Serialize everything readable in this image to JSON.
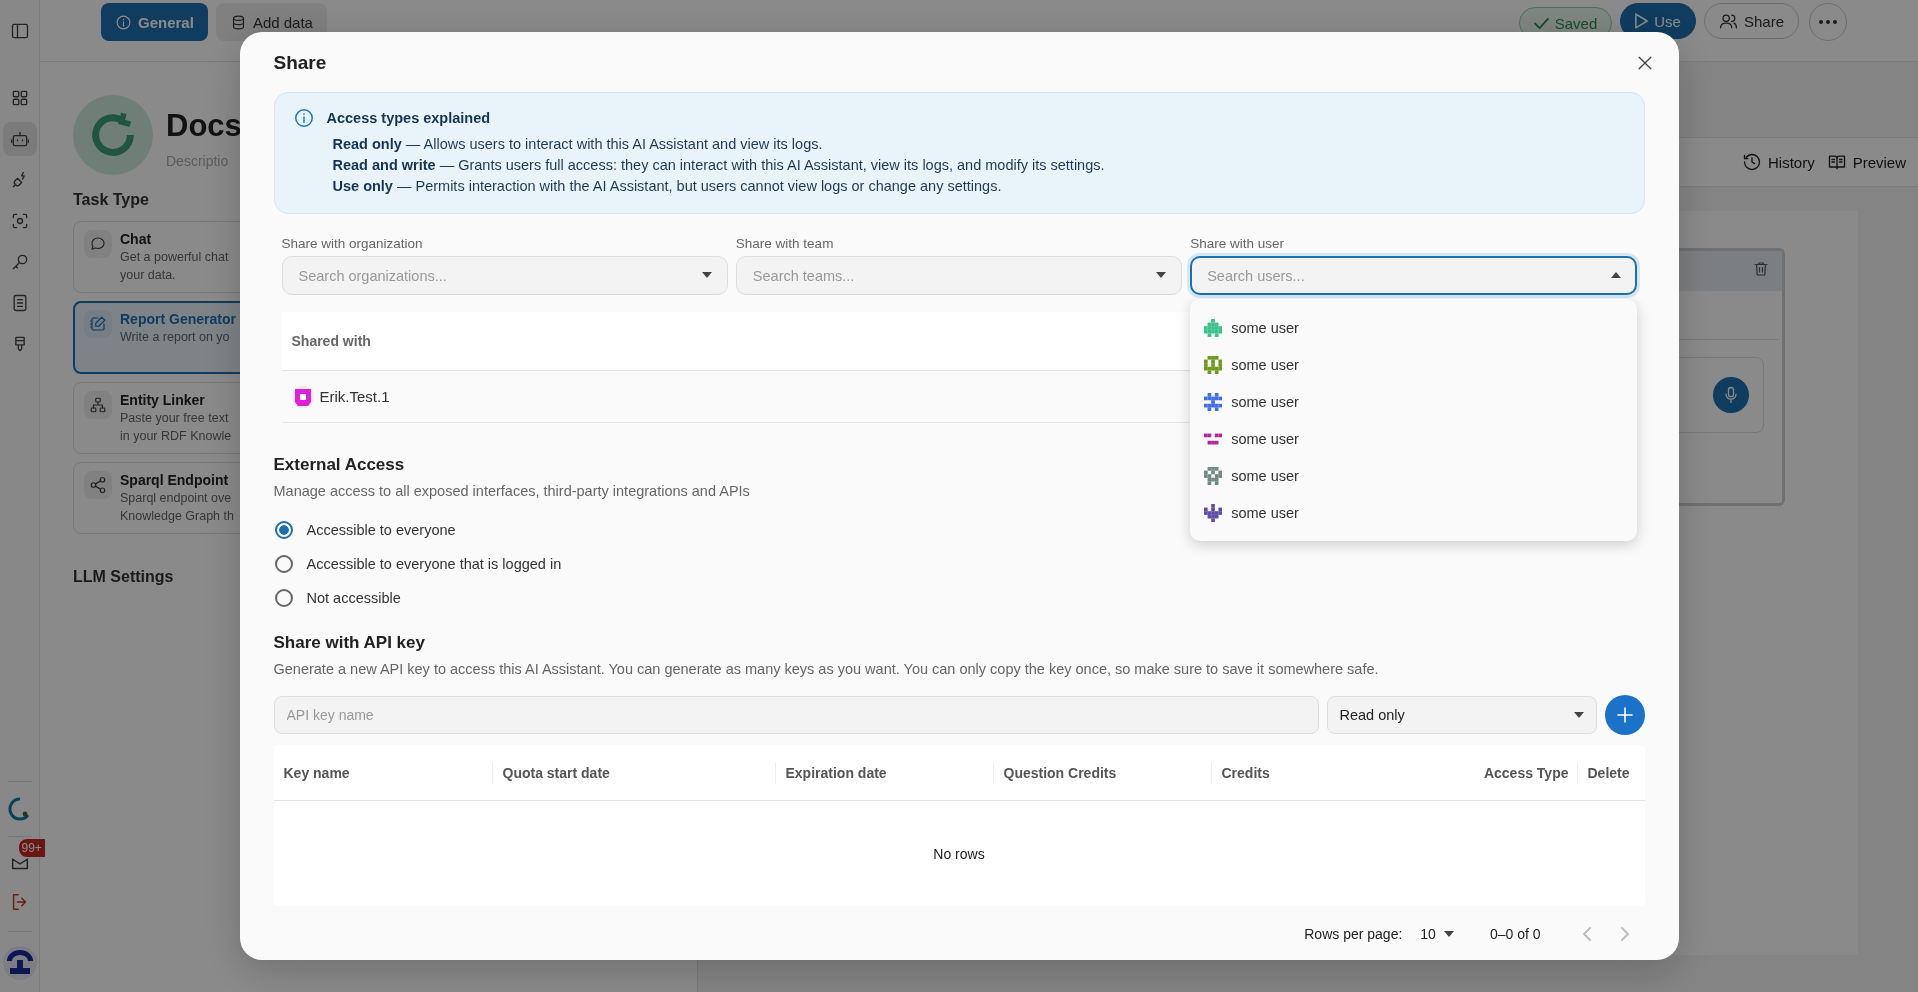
{
  "sidebar": {
    "items": [
      {
        "selected": false
      },
      {
        "selected": true
      },
      {
        "selected": false
      },
      {
        "selected": false
      },
      {
        "selected": false
      },
      {
        "selected": false
      },
      {
        "selected": false
      }
    ],
    "inbox_badge": "99+"
  },
  "top_bar": {
    "tabs": [
      {
        "label": "General",
        "selected": true
      },
      {
        "label": "Add data",
        "selected": false
      }
    ],
    "saved": "Saved",
    "use": "Use",
    "share": "Share"
  },
  "assistant": {
    "name": "Docs",
    "placeholder": "Descriptio"
  },
  "task_type": {
    "title": "Task Type",
    "options": [
      {
        "title": "Chat",
        "description": [
          "Get a powerful chat",
          "your data."
        ],
        "selected": false
      },
      {
        "title": "Report Generator",
        "description": [
          "Write a report on yo"
        ],
        "selected": true
      },
      {
        "title": "Entity Linker",
        "description": [
          "Paste your free text",
          "in your RDF Knowle"
        ],
        "selected": false
      },
      {
        "title": "Sparql Endpoint",
        "description": [
          "Sparql endpoint ove",
          "Knowledge Graph th"
        ],
        "selected": false
      }
    ]
  },
  "llm_settings": {
    "title": "LLM Settings"
  },
  "preview_toolbar": {
    "history": "History",
    "preview": "Preview"
  },
  "share_dialog": {
    "title": "Share",
    "info": {
      "title": "Access types explained",
      "lines": [
        "**Read only** — Allows users to interact with this AI Assistant and view its logs.",
        "**Read and write** — Grants users full access: they can interact with this AI Assistant, view its logs, and modify its settings.",
        "**Use only** — Permits interaction with the AI Assistant, but users cannot view logs or change any settings."
      ]
    },
    "fields": [
      {
        "label": "Share with organization",
        "placeholder": "Search organizations...",
        "open": false
      },
      {
        "label": "Share with team",
        "placeholder": "Search teams...",
        "open": false
      },
      {
        "label": "Share with user",
        "placeholder": "Search users...",
        "open": true
      }
    ],
    "user_options": [
      {
        "name": "some user",
        "color": "#3cc08c"
      },
      {
        "name": "some user",
        "color": "#6b9a1f"
      },
      {
        "name": "some user",
        "color": "#3f6ee8"
      },
      {
        "name": "some user",
        "color": "#b0259e"
      },
      {
        "name": "some user",
        "color": "#6f8a84"
      },
      {
        "name": "some user",
        "color": "#5e4ca8"
      }
    ],
    "shared_with": {
      "header": "Shared with",
      "users": [
        {
          "name": "Erik.Test.1",
          "color": "#e020d8"
        }
      ]
    },
    "external_access": {
      "title": "External Access",
      "description": "Manage access to all exposed interfaces, third-party integrations and APIs",
      "options": [
        {
          "label": "Accessible to everyone",
          "selected": true
        },
        {
          "label": "Accessible to everyone that is logged in",
          "selected": false
        },
        {
          "label": "Not accessible",
          "selected": false
        }
      ]
    },
    "api_key": {
      "title": "Share with API key",
      "description": "Generate a new API key to access this AI Assistant. You can generate as many keys as you want. You can only copy the key once, so make sure to save it somewhere safe.",
      "placeholder": "API key name",
      "access": "Read only",
      "columns": [
        "Key name",
        "Quota start date",
        "Expiration date",
        "Question Credits",
        "Credits",
        "Access Type",
        "Delete"
      ],
      "empty": "No rows",
      "rows_per_page_label": "Rows per page:",
      "rows_per_page": "10",
      "range": "0–0 of 0"
    }
  }
}
